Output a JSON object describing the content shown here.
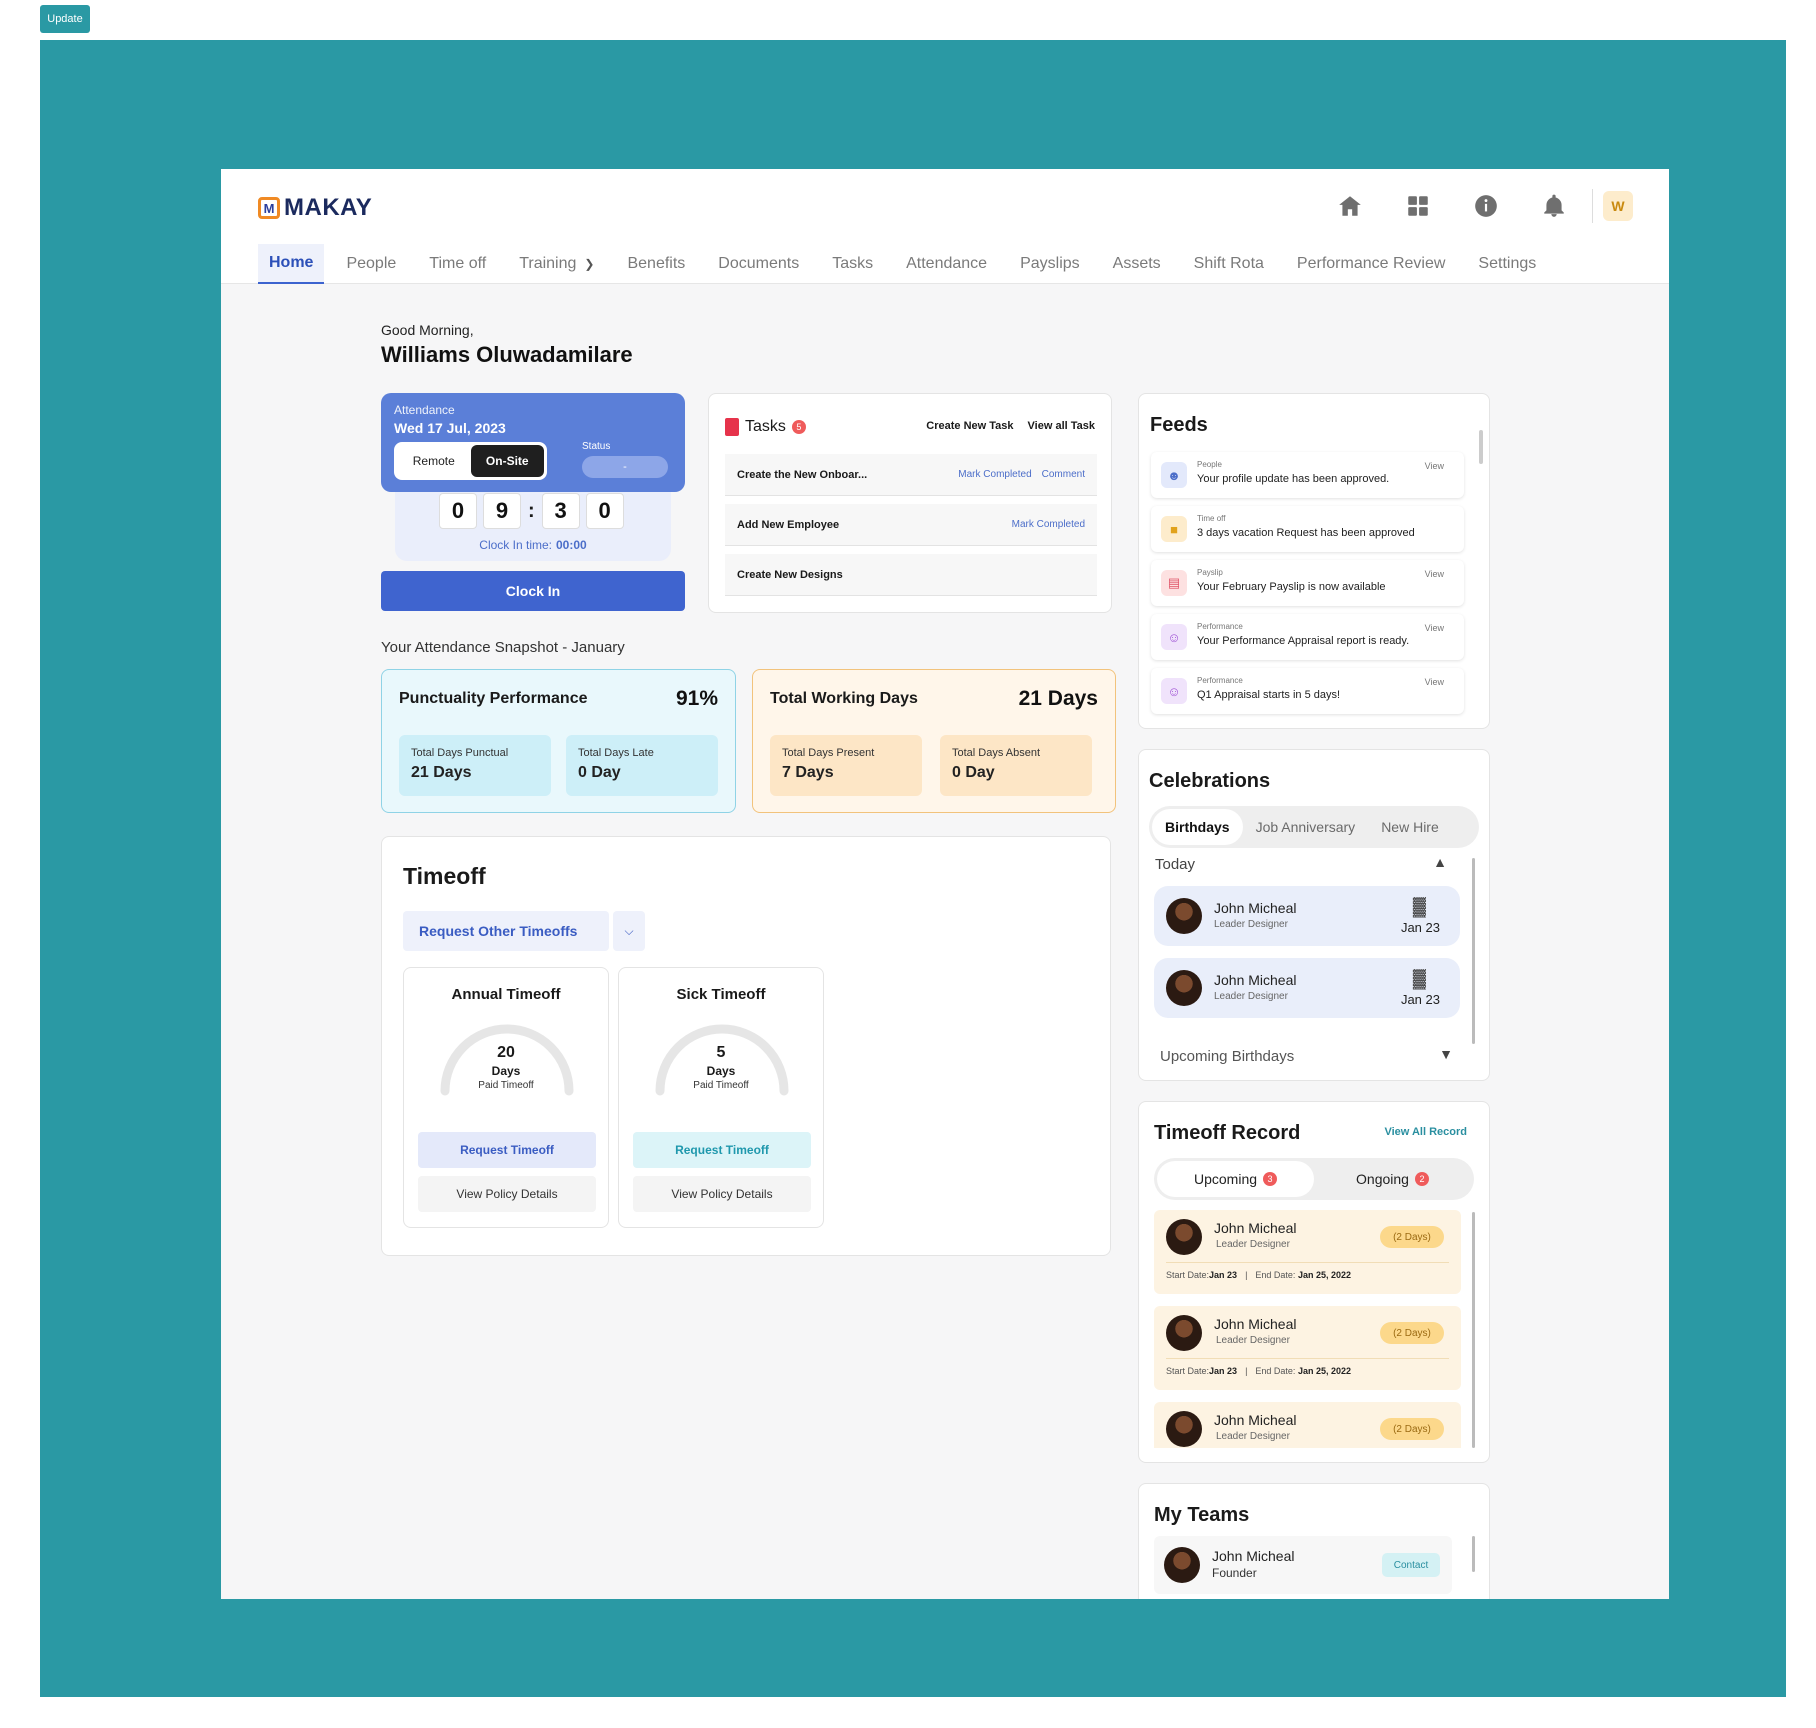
{
  "update_button": "Update",
  "brand": {
    "mark": "M",
    "name": "MAKAY"
  },
  "user_initial": "W",
  "nav": [
    {
      "label": "Home"
    },
    {
      "label": "People"
    },
    {
      "label": "Time off"
    },
    {
      "label": "Training"
    },
    {
      "label": "Benefits"
    },
    {
      "label": "Documents"
    },
    {
      "label": "Tasks"
    },
    {
      "label": "Attendance"
    },
    {
      "label": "Payslips"
    },
    {
      "label": "Assets"
    },
    {
      "label": "Shift Rota"
    },
    {
      "label": "Performance Review"
    },
    {
      "label": "Settings"
    }
  ],
  "greeting": {
    "line1": "Good Morning,",
    "name": "Williams Oluwadamilare"
  },
  "attendance": {
    "label": "Attendance",
    "date": "Wed 17 Jul, 2023",
    "modes": [
      "Remote",
      "On-Site"
    ],
    "selected_mode": "On-Site",
    "status_label": "Status",
    "status_value": "-",
    "digits": [
      "0",
      "9",
      "3",
      "0"
    ],
    "clock_in_label": "Clock In time:",
    "clock_in_value": "00:00",
    "clock_in_button": "Clock In"
  },
  "tasks": {
    "title": "Tasks",
    "count": "5",
    "create_link": "Create New Task",
    "view_link": "View all Task",
    "items": [
      {
        "name": "Create the New Onboar...",
        "actions": [
          "Mark Completed",
          "Comment"
        ]
      },
      {
        "name": "Add New Employee",
        "actions": [
          "Mark Completed"
        ]
      },
      {
        "name": "Create New Designs",
        "actions": []
      }
    ]
  },
  "snapshot": {
    "title": "Your Attendance Snapshot - January",
    "punctuality": {
      "title": "Punctuality Performance",
      "value": "91%",
      "a_label": "Total Days Punctual",
      "a_value": "21 Days",
      "b_label": "Total Days Late",
      "b_value": "0 Day"
    },
    "working": {
      "title": "Total Working Days",
      "value": "21 Days",
      "a_label": "Total Days Present",
      "a_value": "7 Days",
      "b_label": "Total Days Absent",
      "b_value": "0 Day"
    }
  },
  "timeoff": {
    "title": "Timeoff",
    "request_other": "Request Other Timeoffs",
    "cards": [
      {
        "title": "Annual  Timeoff",
        "days": "20",
        "unit": "Days",
        "sub": "Paid Timeoff",
        "request": "Request Timeoff",
        "policy": "View Policy Details"
      },
      {
        "title": "Sick Timeoff",
        "days": "5",
        "unit": "Days",
        "sub": "Paid Timeoff",
        "request": "Request Timeoff",
        "policy": "View Policy Details"
      }
    ]
  },
  "feeds": {
    "title": "Feeds",
    "items": [
      {
        "cat": "People",
        "msg": "Your profile update has been approved.",
        "view": "View",
        "icon": "person-icon",
        "color": "#e3e9fb"
      },
      {
        "cat": "Time off",
        "msg": "3 days vacation Request has been approved",
        "view": "",
        "icon": "calendar-icon",
        "color": "#fdeccc"
      },
      {
        "cat": "Payslip",
        "msg": "Your February Payslip is now available",
        "view": "View",
        "icon": "receipt-icon",
        "color": "#fde1e1"
      },
      {
        "cat": "Performance",
        "msg": "Your Performance Appraisal report is ready.",
        "view": "View",
        "icon": "performance-icon",
        "color": "#f0e3fb"
      },
      {
        "cat": "Performance",
        "msg": "Q1 Appraisal starts in 5 days!",
        "view": "View",
        "icon": "performance-icon",
        "color": "#f0e3fb"
      }
    ]
  },
  "celebrations": {
    "title": "Celebrations",
    "tabs": [
      "Birthdays",
      "Job Anniversary",
      "New Hire"
    ],
    "today": "Today",
    "people": [
      {
        "name": "John Micheal",
        "role": "Leader Designer",
        "date": "Jan 23"
      },
      {
        "name": "John Micheal",
        "role": "Leader Designer",
        "date": "Jan 23"
      }
    ],
    "upcoming": "Upcoming Birthdays"
  },
  "timeoff_record": {
    "title": "Timeoff Record",
    "link": "View All Record",
    "tabs": [
      {
        "label": "Upcoming",
        "count": "3"
      },
      {
        "label": "Ongoing",
        "count": "2"
      }
    ],
    "items": [
      {
        "name": "John Micheal",
        "role": "Leader Designer",
        "days": "(2 Days)",
        "start_label": "Start Date:",
        "start": "Jan 23",
        "end_label": "End Date:",
        "end": "Jan 25, 2022"
      },
      {
        "name": "John Micheal",
        "role": "Leader Designer",
        "days": "(2 Days)",
        "start_label": "Start Date:",
        "start": "Jan 23",
        "end_label": "End Date:",
        "end": "Jan 25, 2022"
      },
      {
        "name": "John Micheal",
        "role": "Leader Designer",
        "days": "(2 Days)"
      }
    ]
  },
  "teams": {
    "title": "My Teams",
    "members": [
      {
        "name": "John Micheal",
        "role": "Founder",
        "action": "Contact"
      }
    ]
  }
}
